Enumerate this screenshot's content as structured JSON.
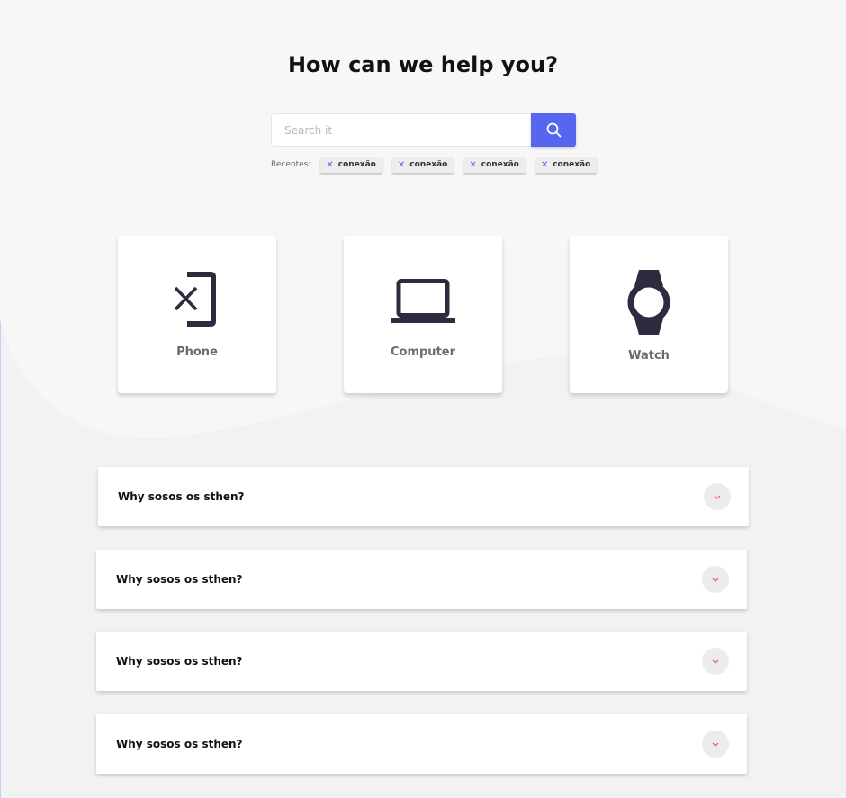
{
  "colors": {
    "accent": "#5766ef",
    "chevron": "#e0489e",
    "icon": "#2e2b3f"
  },
  "header": {
    "title": "How can we help you?"
  },
  "search": {
    "placeholder": "Search it",
    "button_icon": "search-icon"
  },
  "recents": {
    "label": "Recentes:",
    "chips": [
      {
        "text": "conexão"
      },
      {
        "text": "conexão"
      },
      {
        "text": "conexão"
      },
      {
        "text": "conexão"
      }
    ]
  },
  "categories": [
    {
      "label": "Phone",
      "icon": "phone-off-icon"
    },
    {
      "label": "Computer",
      "icon": "laptop-icon"
    },
    {
      "label": "Watch",
      "icon": "watch-icon"
    }
  ],
  "faq": [
    {
      "question": "Why sosos os sthen?"
    },
    {
      "question": "Why sosos os sthen?"
    },
    {
      "question": "Why sosos os sthen?"
    },
    {
      "question": "Why sosos os sthen?"
    }
  ]
}
